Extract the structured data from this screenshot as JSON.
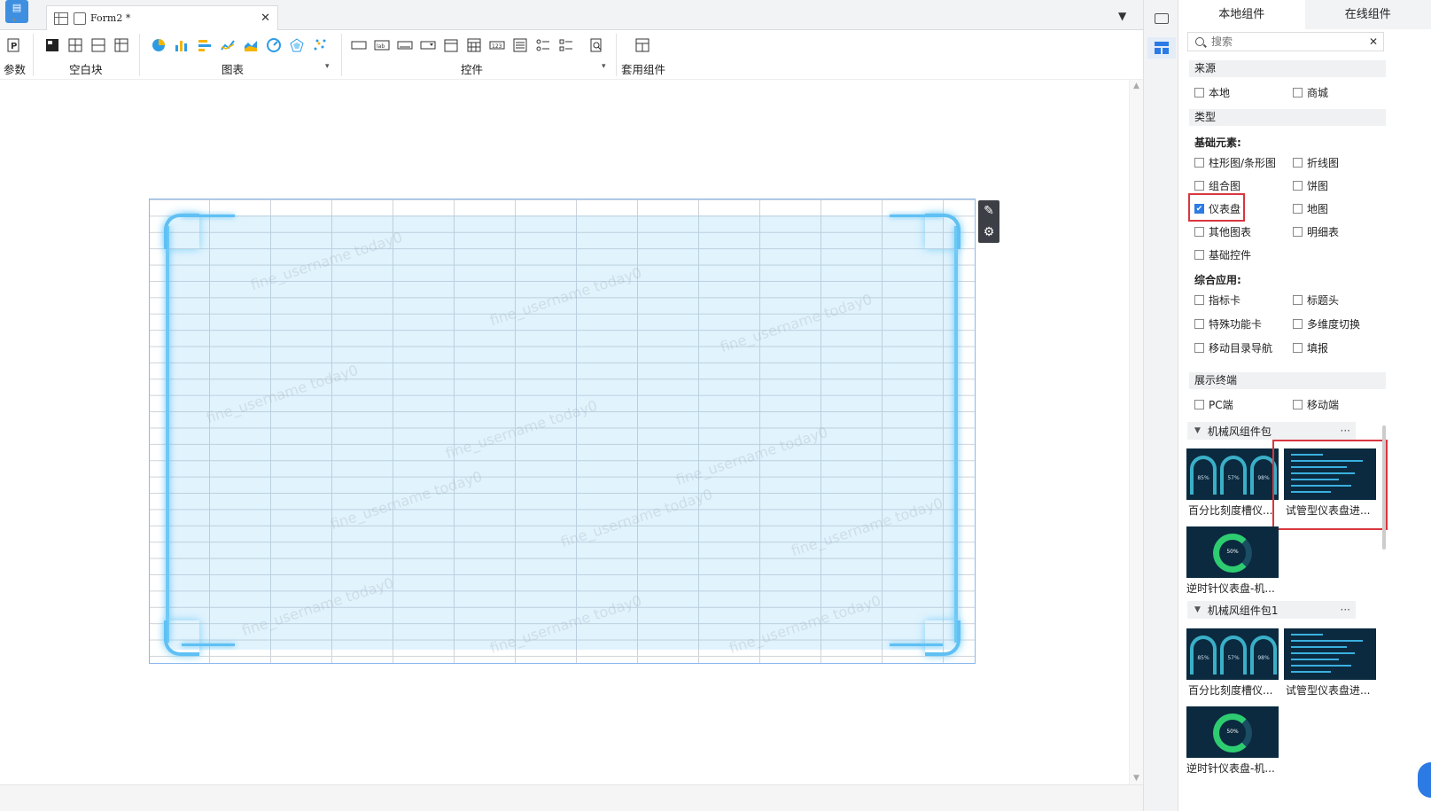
{
  "tab": {
    "title": "Form2 *",
    "close": "✕"
  },
  "toolbar": {
    "param_label": "参数",
    "blank_label": "空白块",
    "chart_label": "图表",
    "widget_label": "控件",
    "suite_label": "套用组件"
  },
  "right_panel": {
    "tabs": [
      "本地组件",
      "在线组件"
    ],
    "search_placeholder": "搜索",
    "source_title": "来源",
    "source_options": [
      "本地",
      "商城"
    ],
    "type_title": "类型",
    "basic_title": "基础元素:",
    "basic_options": [
      "柱形图/条形图",
      "折线图",
      "组合图",
      "饼图",
      "仪表盘",
      "地图",
      "其他图表",
      "明细表",
      "基础控件"
    ],
    "checked": "仪表盘",
    "composite_title": "综合应用:",
    "composite_options": [
      "指标卡",
      "标题头",
      "特殊功能卡",
      "多维度切换",
      "移动目录导航",
      "填报"
    ],
    "terminal_title": "展示终端",
    "terminal_options": [
      "PC端",
      "移动端"
    ],
    "packages": [
      {
        "name": "机械风组件包",
        "more": "···",
        "items": [
          "百分比刻度槽仪...",
          "试管型仪表盘进...",
          "逆时针仪表盘-机..."
        ]
      },
      {
        "name": "机械风组件包1",
        "more": "···",
        "items": [
          "百分比刻度槽仪...",
          "试管型仪表盘进...",
          "逆时针仪表盘-机..."
        ]
      }
    ],
    "gauge_values": [
      "85%",
      "57%",
      "98%"
    ],
    "donut_value": "50%"
  },
  "canvas": {
    "watermark": "fine_username today0"
  },
  "colors": {
    "accent": "#2c7be5",
    "highlight": "#d9363e",
    "glow": "#5fc0f4"
  }
}
